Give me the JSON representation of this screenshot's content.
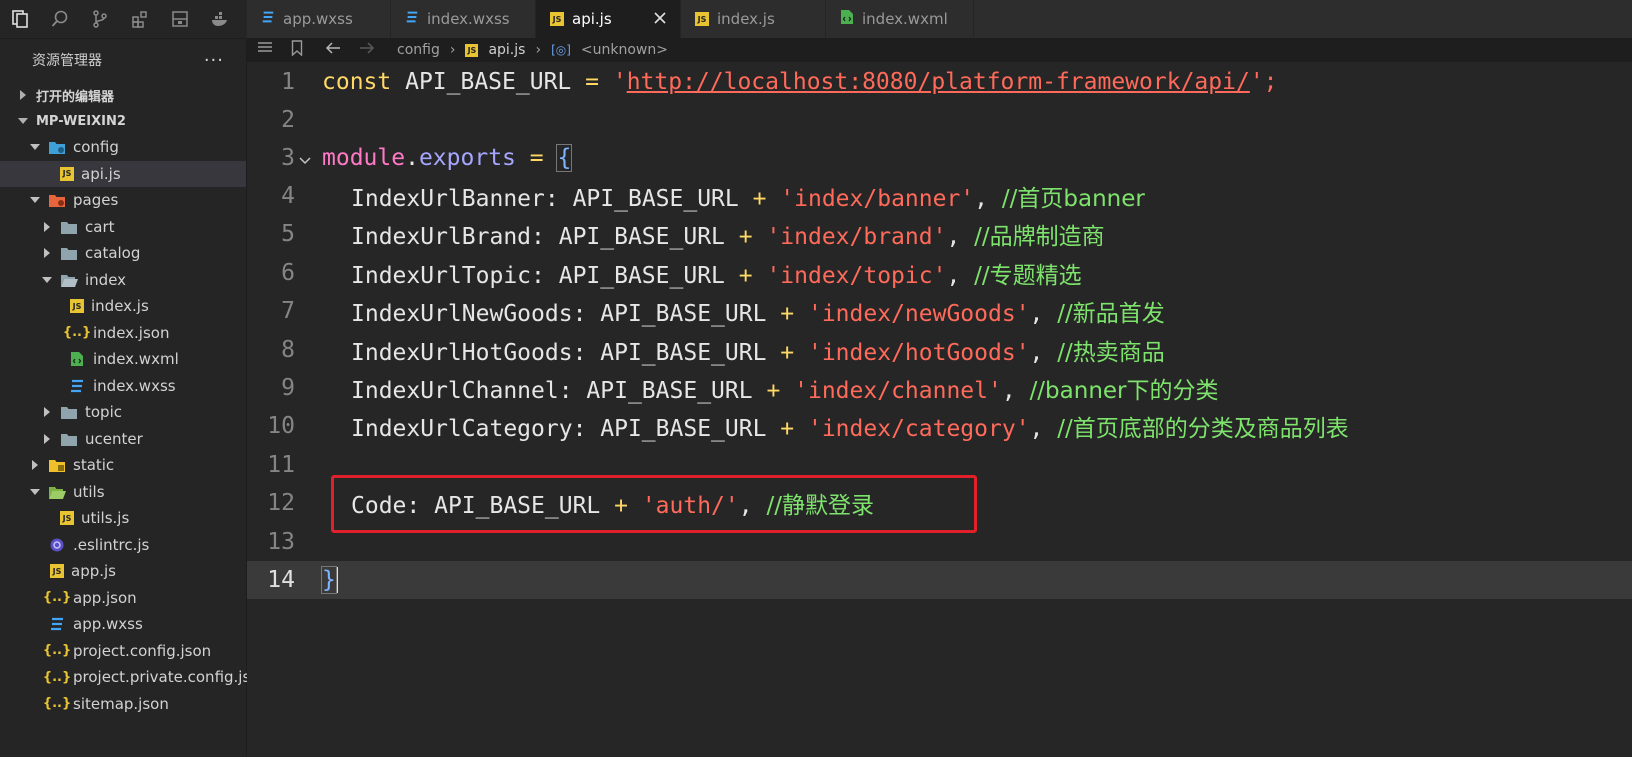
{
  "explorer": {
    "title": "资源管理器",
    "more": "···",
    "sections": {
      "open_editors": "打开的编辑器",
      "project": "MP-WEIXIN2"
    },
    "tree": [
      {
        "label": "config"
      },
      {
        "label": "api.js"
      },
      {
        "label": "pages"
      },
      {
        "label": "cart"
      },
      {
        "label": "catalog"
      },
      {
        "label": "index"
      },
      {
        "label": "index.js"
      },
      {
        "label": "index.json"
      },
      {
        "label": "index.wxml"
      },
      {
        "label": "index.wxss"
      },
      {
        "label": "topic"
      },
      {
        "label": "ucenter"
      },
      {
        "label": "static"
      },
      {
        "label": "utils"
      },
      {
        "label": "utils.js"
      },
      {
        "label": ".eslintrc.js"
      },
      {
        "label": "app.js"
      },
      {
        "label": "app.json"
      },
      {
        "label": "app.wxss"
      },
      {
        "label": "project.config.json"
      },
      {
        "label": "project.private.config.js..."
      },
      {
        "label": "sitemap.json"
      }
    ]
  },
  "tabs": [
    {
      "label": "app.wxss"
    },
    {
      "label": "index.wxss"
    },
    {
      "label": "api.js"
    },
    {
      "label": "index.js"
    },
    {
      "label": "index.wxml"
    }
  ],
  "breadcrumb": {
    "folder": "config",
    "file": "api.js",
    "symbol": "<unknown>"
  },
  "editor": {
    "line_numbers": [
      "1",
      "2",
      "3",
      "4",
      "5",
      "6",
      "7",
      "8",
      "9",
      "10",
      "11",
      "12",
      "13",
      "14"
    ],
    "line1": {
      "kw": "const",
      "name": " API_BASE_URL ",
      "eq": "=",
      "q1": " '",
      "url": "http://localhost:8080/platform-framework/api/",
      "q2": "';"
    },
    "line3": {
      "mod": "module",
      "dot": ".",
      "exp": "exports",
      "eq": " = ",
      "brace": "{"
    },
    "entries": [
      {
        "key": "IndexUrlBanner",
        "base": "API_BASE_URL",
        "path": "'index/banner'",
        "comment": "//首页banner"
      },
      {
        "key": "IndexUrlBrand",
        "base": "API_BASE_URL",
        "path": "'index/brand'",
        "comment": "//品牌制造商"
      },
      {
        "key": "IndexUrlTopic",
        "base": "API_BASE_URL",
        "path": "'index/topic'",
        "comment": "//专题精选"
      },
      {
        "key": "IndexUrlNewGoods",
        "base": "API_BASE_URL",
        "path": "'index/newGoods'",
        "comment": "//新品首发"
      },
      {
        "key": "IndexUrlHotGoods",
        "base": "API_BASE_URL",
        "path": "'index/hotGoods'",
        "comment": "//热卖商品"
      },
      {
        "key": "IndexUrlChannel",
        "base": "API_BASE_URL",
        "path": "'index/channel'",
        "comment": "//banner下的分类"
      },
      {
        "key": "IndexUrlCategory",
        "base": "API_BASE_URL",
        "path": "'index/category'",
        "comment": "//首页底部的分类及商品列表"
      }
    ],
    "line12": {
      "key": "Code",
      "base": "API_BASE_URL",
      "path": "'auth/'",
      "comment": "//静默登录"
    },
    "line14": {
      "brace": "}"
    },
    "colors": {
      "highlight_box": "#e0202a"
    }
  }
}
